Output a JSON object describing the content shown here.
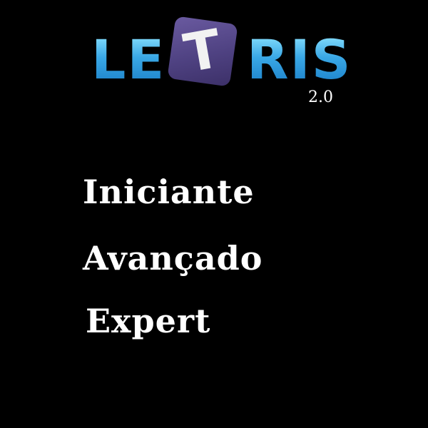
{
  "logo": {
    "left_text": "LE",
    "tile_letter": "T",
    "right_text": "RIS"
  },
  "version": "2.0",
  "menu": {
    "items": [
      {
        "label": "Iniciante"
      },
      {
        "label": "Avançado"
      },
      {
        "label": "Expert"
      }
    ]
  },
  "colors": {
    "background": "#000000",
    "logo_blue": "#3aa8e6",
    "tile_purple": "#4f4282",
    "text": "#ffffff"
  }
}
